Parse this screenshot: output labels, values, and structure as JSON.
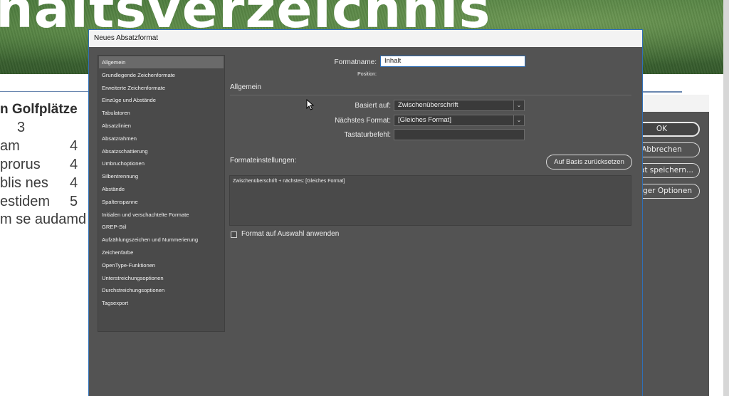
{
  "background_doc": {
    "title": "haltsverzeichnis",
    "heading": "n Golfplätze",
    "rows": [
      {
        "text": "3",
        "num": ""
      },
      {
        "text": "am",
        "num": "4"
      },
      {
        "text": "prorus",
        "num": "4"
      },
      {
        "text": "blis nes",
        "num": "4"
      },
      {
        "text": "estidem",
        "num": "5"
      },
      {
        "text": "m se audamd",
        "num": ""
      }
    ]
  },
  "back_dialog": {
    "ok_label": "OK",
    "cancel_label": "Abbrechen",
    "save_label": "mat speichern...",
    "less_label": "niger Optionen"
  },
  "dialog": {
    "title": "Neues Absatzformat",
    "categories": [
      "Allgemein",
      "Grundlegende Zeichenformate",
      "Erweiterte Zeichenformate",
      "Einzüge und Abstände",
      "Tabulatoren",
      "Absatzlinien",
      "Absatzrahmen",
      "Absatzschattierung",
      "Umbruchoptionen",
      "Silbentrennung",
      "Abstände",
      "Spaltenspanne",
      "Initialen und verschachtelte Formate",
      "GREP-Stil",
      "Aufzählungszeichen und Nummerierung",
      "Zeichenfarbe",
      "OpenType-Funktionen",
      "Unterstreichungsoptionen",
      "Durchstreichungsoptionen",
      "Tagsexport"
    ],
    "selected_category": "Allgemein",
    "format_name_label": "Formatname:",
    "format_name_value": "Inhalt",
    "position_label": "Position:",
    "section_general": "Allgemein",
    "based_on_label": "Basiert auf:",
    "based_on_value": "Zwischenüberschrift",
    "next_format_label": "Nächstes Format:",
    "next_format_value": "[Gleiches Format]",
    "shortcut_label": "Tastaturbefehl:",
    "shortcut_value": "",
    "settings_label": "Formateinstellungen:",
    "reset_button": "Auf Basis zurücksetzen",
    "summary": "Zwischenüberschrift + nächstes: [Gleiches Format]",
    "apply_label": "Format auf Auswahl anwenden",
    "apply_checked": false
  },
  "colors": {
    "dialog_bg": "#535353",
    "accent_blue": "#2f6fb6",
    "selection": "#6a6a6a"
  }
}
